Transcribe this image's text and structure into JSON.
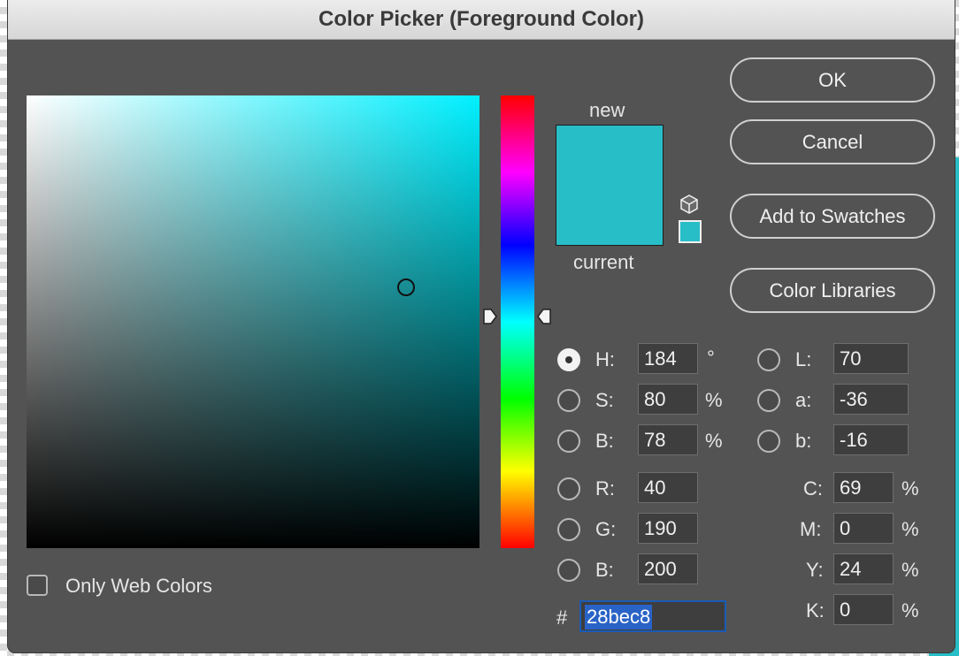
{
  "window": {
    "title": "Color Picker (Foreground Color)"
  },
  "colors": {
    "current_hex": "#28bec8",
    "accent": "#2a63c7"
  },
  "preview": {
    "new_label": "new",
    "current_label": "current"
  },
  "buttons": {
    "ok": "OK",
    "cancel": "Cancel",
    "add_to_swatches": "Add to Swatches",
    "color_libraries": "Color Libraries"
  },
  "hsb": {
    "h": {
      "label": "H:",
      "value": "184",
      "unit": "°"
    },
    "s": {
      "label": "S:",
      "value": "80",
      "unit": "%"
    },
    "b": {
      "label": "B:",
      "value": "78",
      "unit": "%"
    }
  },
  "lab": {
    "l": {
      "label": "L:",
      "value": "70"
    },
    "a": {
      "label": "a:",
      "value": "-36"
    },
    "b": {
      "label": "b:",
      "value": "-16"
    }
  },
  "rgb": {
    "r": {
      "label": "R:",
      "value": "40"
    },
    "g": {
      "label": "G:",
      "value": "190"
    },
    "b": {
      "label": "B:",
      "value": "200"
    }
  },
  "cmyk": {
    "c": {
      "label": "C:",
      "value": "69",
      "unit": "%"
    },
    "m": {
      "label": "M:",
      "value": "0",
      "unit": "%"
    },
    "y": {
      "label": "Y:",
      "value": "24",
      "unit": "%"
    },
    "k": {
      "label": "K:",
      "value": "0",
      "unit": "%"
    }
  },
  "hex": {
    "label": "#",
    "value": "28bec8"
  },
  "options": {
    "only_web_colors": "Only Web Colors"
  },
  "icons": {
    "gamut": "cube-icon"
  }
}
